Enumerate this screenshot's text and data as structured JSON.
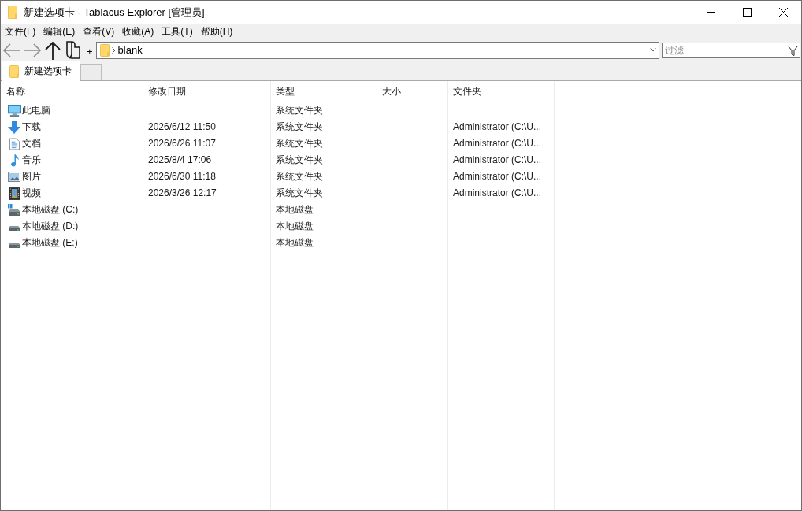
{
  "window": {
    "title": "新建选项卡 - Tablacus Explorer [管理员]"
  },
  "menu_bar": [
    "文件(F)",
    "编辑(E)",
    "查看(V)",
    "收藏(A)",
    "工具(T)",
    "帮助(H)"
  ],
  "toolbar": {
    "buttons": [
      {
        "kind": "back",
        "disabled": true
      },
      {
        "kind": "forward",
        "disabled": true
      },
      {
        "kind": "up",
        "disabled": false
      },
      {
        "kind": "page",
        "disabled": false
      }
    ],
    "add_button": "+",
    "address": {
      "value": "blank"
    },
    "filter": {
      "placeholder": "过滤"
    }
  },
  "tabs": [
    {
      "label": "新建选项卡",
      "selected": true
    }
  ],
  "new_tab_button": "+",
  "table": {
    "columns": [
      "名称",
      "修改日期",
      "类型",
      "大小",
      "文件夹"
    ],
    "rows": [
      {
        "kind": "computer",
        "name": "此电脑",
        "type": "系统文件夹"
      },
      {
        "kind": "download",
        "name": "下载",
        "modified": "2026/6/12 11:50",
        "type": "系统文件夹",
        "folder": "Administrator (C:\\U..."
      },
      {
        "kind": "document",
        "name": "文档",
        "modified": "2026/6/26 11:07",
        "type": "系统文件夹",
        "folder": "Administrator (C:\\U..."
      },
      {
        "kind": "music",
        "name": "音乐",
        "modified": "2025/8/4 17:06",
        "type": "系统文件夹",
        "folder": "Administrator (C:\\U..."
      },
      {
        "kind": "picture",
        "name": "图片",
        "modified": "2026/6/30 11:18",
        "type": "系统文件夹",
        "folder": "Administrator (C:\\U..."
      },
      {
        "kind": "video",
        "name": "视频",
        "modified": "2026/3/26 12:17",
        "type": "系统文件夹",
        "folder": "Administrator (C:\\U..."
      },
      {
        "kind": "system-drive",
        "name": "本地磁盘 (C:)",
        "type": "本地磁盘"
      },
      {
        "kind": "drive",
        "name": "本地磁盘 (D:)",
        "type": "本地磁盘"
      },
      {
        "kind": "drive",
        "name": "本地磁盘 (E:)",
        "type": "本地磁盘"
      }
    ]
  }
}
